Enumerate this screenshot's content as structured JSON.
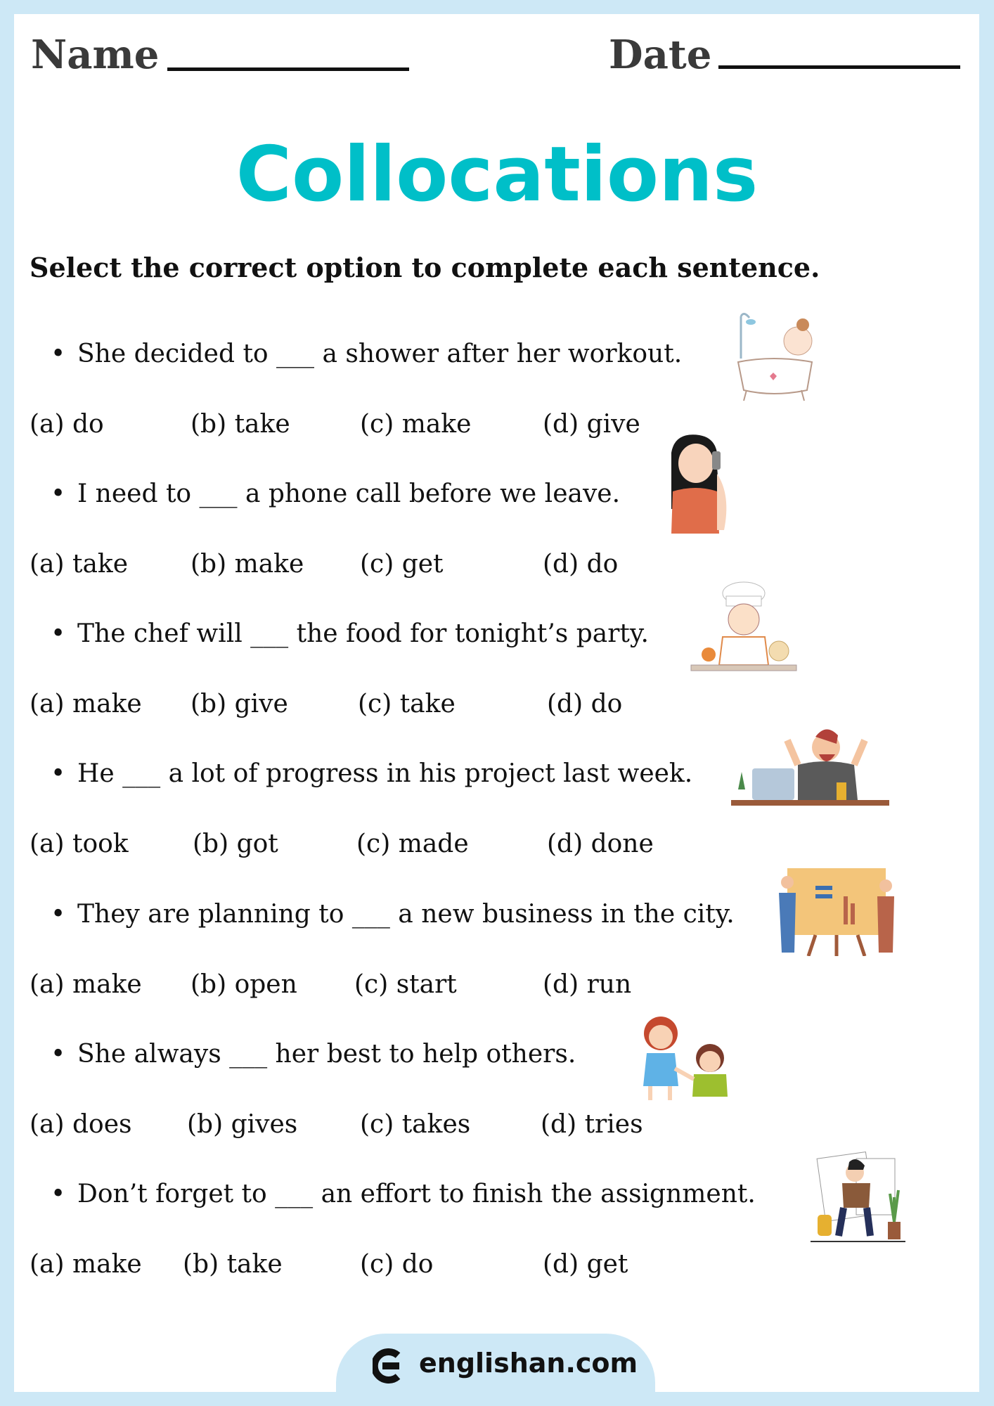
{
  "header": {
    "name_label": "Name",
    "date_label": "Date"
  },
  "title": "Collocations",
  "instruction": "Select the correct option to complete each sentence.",
  "questions": [
    {
      "sentence": "She decided to ___ a shower after her workout.",
      "illustration": "woman-in-bathtub-shower",
      "options": [
        "(a) do",
        "(b) take",
        "(c) make",
        "(d) give"
      ]
    },
    {
      "sentence": "I need to ___ a phone call before we leave.",
      "illustration": "woman-on-phone",
      "options": [
        "(a) take",
        "(b) make",
        "(c) get",
        "(d) do"
      ]
    },
    {
      "sentence": "The chef will ___ the food for tonight’s party.",
      "illustration": "chef-with-food",
      "options": [
        "(a) make",
        "(b) give",
        "(c) take",
        "(d) do"
      ]
    },
    {
      "sentence": "He ___ a lot of progress in his project last week.",
      "illustration": "man-celebrating-at-laptop",
      "options": [
        "(a) took",
        "(b) got",
        "(c) made",
        "(d) done"
      ]
    },
    {
      "sentence": "They are planning to ___ a new business in the city.",
      "illustration": "people-at-planning-board",
      "options": [
        "(a) make",
        "(b) open",
        "(c) start",
        "(d) run"
      ]
    },
    {
      "sentence": "She always ___ her best to help others.",
      "illustration": "girl-helping-child",
      "options": [
        "(a) does",
        "(b) gives",
        "(c) takes",
        "(d) tries"
      ]
    },
    {
      "sentence": "Don’t forget to ___ an effort to finish the assignment.",
      "illustration": "student-doing-assignment",
      "options": [
        "(a) make",
        "(b) take",
        "(c) do",
        "(d) get"
      ]
    }
  ],
  "footer": {
    "site": "englishan.com"
  },
  "colors": {
    "title": "#00bfc8",
    "border": "#cde8f6",
    "text": "#111111"
  }
}
